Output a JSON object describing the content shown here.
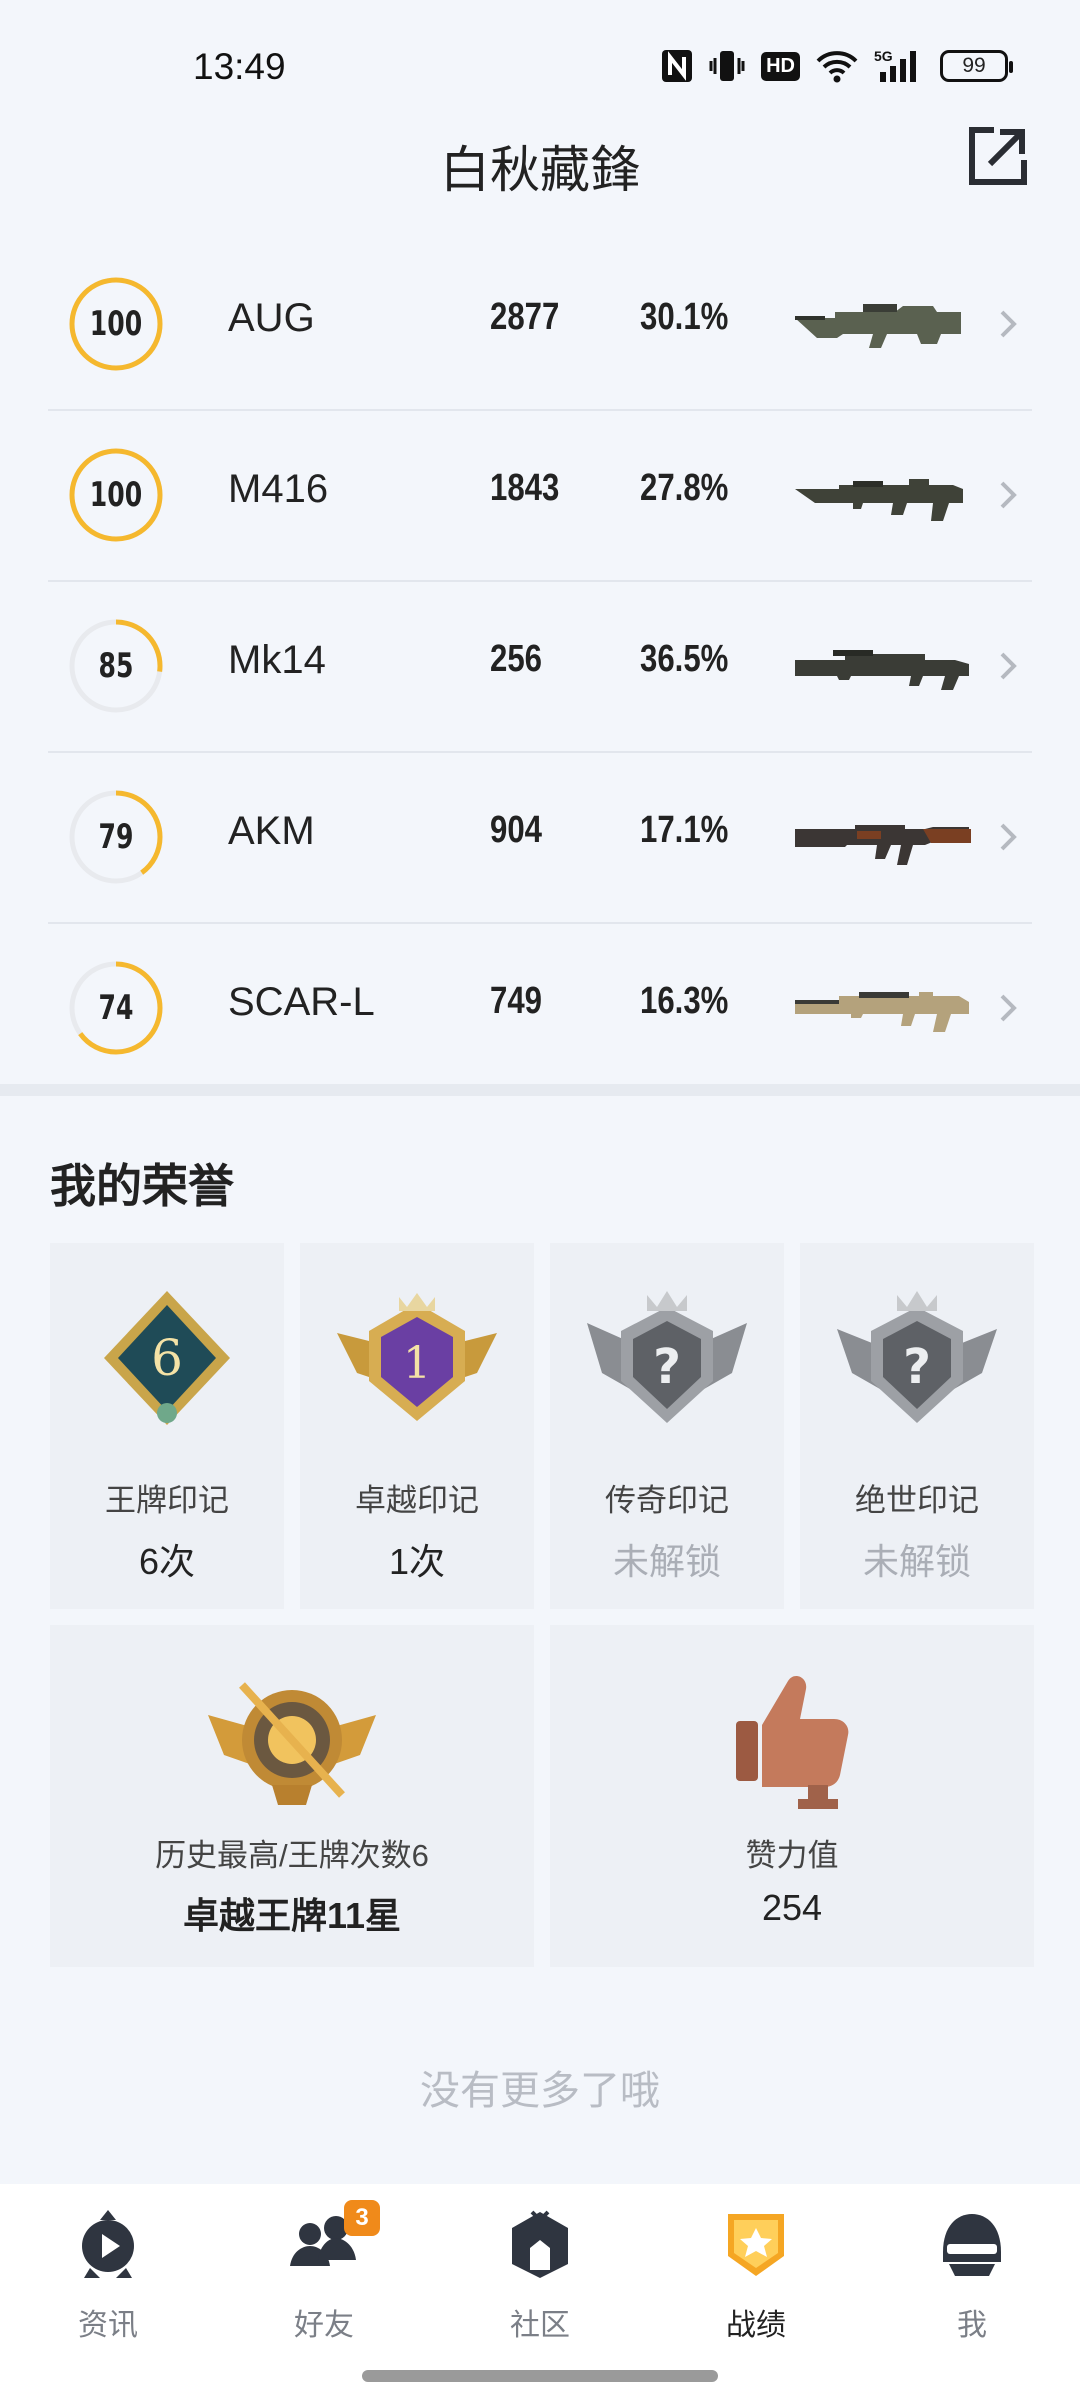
{
  "status_bar": {
    "time": "13:49",
    "battery": "99",
    "hd": "HD",
    "network": "5G",
    "icons": [
      "nfc-icon",
      "vibrate-icon",
      "hd-icon",
      "wifi-icon",
      "signal-5g-icon",
      "battery-icon"
    ]
  },
  "header": {
    "title": "白秋藏鋒",
    "share_icon": "external-share-icon"
  },
  "weapons": [
    {
      "score": "100",
      "score_fraction": 1.0,
      "name": "AUG",
      "kills": "2877",
      "rate": "30.1%",
      "icon": "aug-rifle"
    },
    {
      "score": "100",
      "score_fraction": 1.0,
      "name": "M416",
      "kills": "1843",
      "rate": "27.8%",
      "icon": "m416-rifle"
    },
    {
      "score": "85",
      "score_fraction": 0.27,
      "name": "Mk14",
      "kills": "256",
      "rate": "36.5%",
      "icon": "mk14-rifle"
    },
    {
      "score": "79",
      "score_fraction": 0.4,
      "name": "AKM",
      "kills": "904",
      "rate": "17.1%",
      "icon": "akm-rifle"
    },
    {
      "score": "74",
      "score_fraction": 0.65,
      "name": "SCAR-L",
      "kills": "749",
      "rate": "16.3%",
      "icon": "scar-l-rifle"
    }
  ],
  "colors": {
    "ring_active": "#f5b82e",
    "ring_track": "#e8eaee",
    "accent": "#f08a1a",
    "locked_text": "#aaaeb6"
  },
  "honors": {
    "title": "我的荣誉",
    "cards": [
      {
        "label": "王牌印记",
        "value": "6次",
        "locked": false,
        "emblem": "ace-mark-emblem",
        "emblem_text": "6"
      },
      {
        "label": "卓越印记",
        "value": "1次",
        "locked": false,
        "emblem": "excellence-mark-emblem",
        "emblem_text": "1"
      },
      {
        "label": "传奇印记",
        "value": "未解锁",
        "locked": true,
        "emblem": "legend-mark-emblem",
        "emblem_text": "?"
      },
      {
        "label": "绝世印记",
        "value": "未解锁",
        "locked": true,
        "emblem": "peerless-mark-emblem",
        "emblem_text": "?"
      }
    ],
    "highest": {
      "label": "历史最高/王牌次数6",
      "value": "卓越王牌11星",
      "emblem": "rank-badge-emblem"
    },
    "likes": {
      "label": "赞力值",
      "value": "254",
      "emblem": "thumbs-up-trophy-icon"
    }
  },
  "footer_text": "没有更多了哦",
  "bottom_nav": [
    {
      "label": "资讯",
      "icon": "news-play-icon",
      "active": false
    },
    {
      "label": "好友",
      "icon": "friends-icon",
      "active": false,
      "badge": "3"
    },
    {
      "label": "社区",
      "icon": "community-icon",
      "active": false
    },
    {
      "label": "战绩",
      "icon": "record-badge-icon",
      "active": true
    },
    {
      "label": "我",
      "icon": "helmet-icon",
      "active": false
    }
  ]
}
